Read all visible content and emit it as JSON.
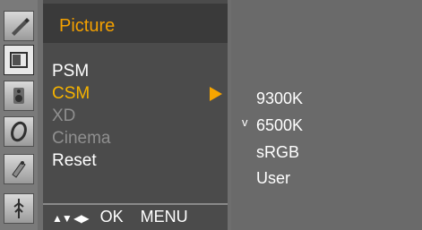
{
  "menu": {
    "title": "Picture",
    "items": [
      {
        "label": "PSM",
        "state": "normal"
      },
      {
        "label": "CSM",
        "state": "selected"
      },
      {
        "label": "XD",
        "state": "disabled"
      },
      {
        "label": "Cinema",
        "state": "disabled"
      },
      {
        "label": "Reset",
        "state": "normal"
      }
    ],
    "footer": {
      "nav": "▲▼ ◀▶",
      "ok": "OK",
      "menu": "MENU"
    }
  },
  "submenu": {
    "items": [
      "9300K",
      "6500K",
      "sRGB",
      "User"
    ],
    "checked": "6500K",
    "check_mark": "v"
  },
  "icons": [
    "pencil-icon",
    "picture-icon",
    "speaker-icon",
    "timer-icon",
    "special-icon",
    "screen-icon"
  ],
  "colors": {
    "accent": "#f6b300",
    "panel": "#4b4b4b",
    "background": "#6e6e6e"
  }
}
